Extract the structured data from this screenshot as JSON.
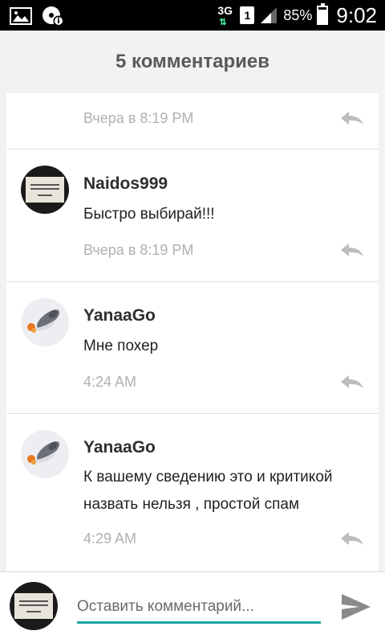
{
  "status_bar": {
    "network": "3G",
    "sim": "1",
    "battery": "85%",
    "battery_level": 0.85,
    "time": "9:02"
  },
  "header": {
    "title": "5 комментариев"
  },
  "comments": [
    {
      "author": "",
      "text": "",
      "time": "Вчера в 8:19 PM"
    },
    {
      "author": "Naidos999",
      "text": "Быстро выбирай!!!",
      "time": "Вчера в 8:19 PM"
    },
    {
      "author": "YanaaGo",
      "text": "Мне похер",
      "time": "4:24 AM"
    },
    {
      "author": "YanaaGo",
      "text": "К вашему сведению это и критикой назвать нельзя , простой спам",
      "time": "4:29 AM"
    }
  ],
  "composer": {
    "placeholder": "Оставить комментарий..."
  },
  "colors": {
    "accent": "#1aa3a6",
    "muted": "#b0b0b0"
  }
}
